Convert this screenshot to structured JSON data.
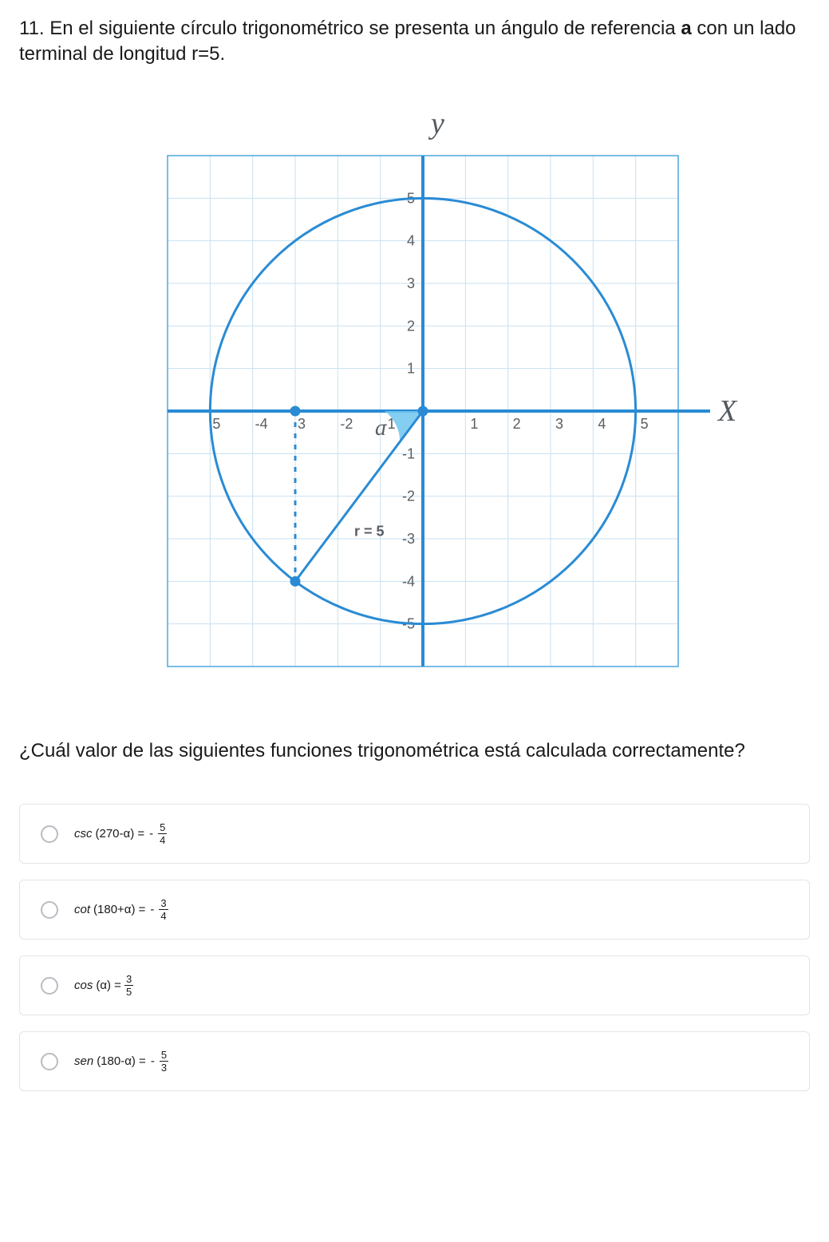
{
  "question_prefix": "11. En el siguiente círculo trigonométrico se presenta un ángulo de referencia ",
  "question_bold": "a",
  "question_suffix": " con un lado terminal de longitud r=5.",
  "subquestion": "¿Cuál valor de las siguientes funciones trigonométrica está calculada correctamente?",
  "chart_data": {
    "type": "diagram",
    "title": "",
    "x_axis_label": "X",
    "y_axis_label": "y",
    "xlim": [
      -6,
      6
    ],
    "ylim": [
      -6,
      6
    ],
    "x_ticks": [
      -5,
      -4,
      -3,
      -2,
      -1,
      1,
      2,
      3,
      4,
      5
    ],
    "y_ticks": [
      5,
      4,
      3,
      2,
      1,
      -1,
      -2,
      -3,
      -4,
      -5
    ],
    "x_tick_labels": [
      "5",
      "-4",
      "3",
      "-2",
      "-1",
      "1",
      "2",
      "3",
      "4",
      "5"
    ],
    "y_tick_labels": [
      "5",
      "4",
      "3",
      "2",
      "1",
      "-1",
      "-2",
      "-3",
      "-4",
      "-5"
    ],
    "circle": {
      "cx": 0,
      "cy": 0,
      "r": 5
    },
    "terminal_point": {
      "x": -3,
      "y": -4
    },
    "segments": [
      {
        "from": [
          0,
          0
        ],
        "to": [
          -3,
          -4
        ],
        "label": "r = 5",
        "style": "solid"
      },
      {
        "from": [
          -3,
          0
        ],
        "to": [
          -3,
          -4
        ],
        "style": "dashed"
      }
    ],
    "origin_point": {
      "x": 0,
      "y": 0
    },
    "axis_point": {
      "x": -3,
      "y": 0
    },
    "angle_label": "a",
    "angle_arc": {
      "from_deg": 180,
      "to_deg": 233.13
    }
  },
  "options": [
    {
      "func": "csc",
      "arg": "(270-α)",
      "neg": true,
      "num": "5",
      "den": "4"
    },
    {
      "func": "cot",
      "arg": "(180+α)",
      "neg": true,
      "num": "3",
      "den": "4"
    },
    {
      "func": "cos",
      "arg": "(α)",
      "neg": false,
      "num": "3",
      "den": "5"
    },
    {
      "func": "sen",
      "arg": "(180-α)",
      "neg": true,
      "num": "5",
      "den": "3"
    }
  ]
}
